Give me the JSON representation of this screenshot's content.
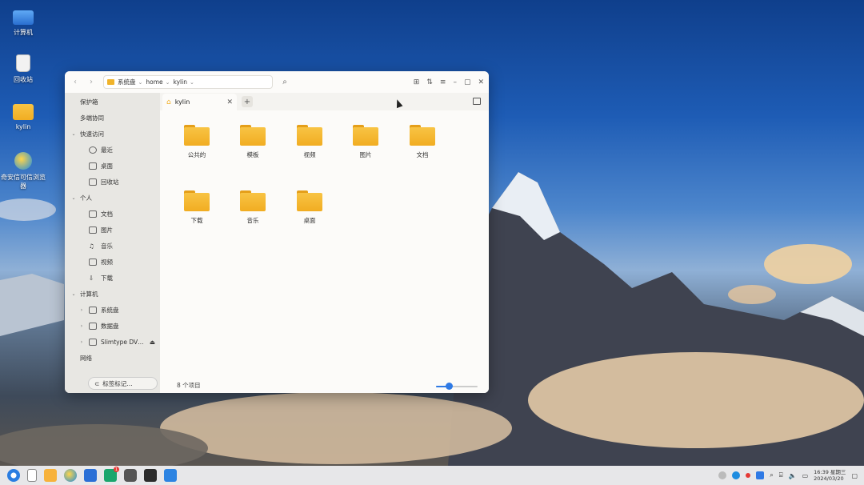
{
  "desktop": {
    "icons": [
      {
        "label": "计算机",
        "icon": "computer-icon"
      },
      {
        "label": "回收站",
        "icon": "trash-icon"
      },
      {
        "label": "kylin",
        "icon": "folder-icon"
      },
      {
        "label": "奇安信可信浏览器",
        "icon": "browser-icon"
      }
    ]
  },
  "window": {
    "nav": {
      "back": "‹",
      "forward": "›"
    },
    "breadcrumb": [
      "系统盘",
      "home",
      "kylin"
    ],
    "search_icon": "⌕",
    "toolbar_right": [
      "⊞",
      "⇅",
      "≡",
      "–",
      "▢",
      "✕"
    ],
    "sidebar": {
      "items": [
        {
          "label": "保护箱",
          "level": 0
        },
        {
          "label": "多端协同",
          "level": 0
        },
        {
          "label": "快速访问",
          "level": 0,
          "expander": "⌄"
        },
        {
          "label": "最近",
          "level": 1
        },
        {
          "label": "桌面",
          "level": 1
        },
        {
          "label": "回收站",
          "level": 1
        },
        {
          "label": "个人",
          "level": 0,
          "expander": "⌄"
        },
        {
          "label": "文档",
          "level": 1
        },
        {
          "label": "图片",
          "level": 1
        },
        {
          "label": "音乐",
          "level": 1
        },
        {
          "label": "视频",
          "level": 1
        },
        {
          "label": "下载",
          "level": 1
        },
        {
          "label": "计算机",
          "level": 0,
          "expander": "⌄"
        },
        {
          "label": "系统盘",
          "level": 1,
          "expander": "›"
        },
        {
          "label": "数据盘",
          "level": 1,
          "expander": "›"
        },
        {
          "label": "Slimtype DV…",
          "level": 1,
          "expander": "›",
          "eject": "⏏"
        },
        {
          "label": "网络",
          "level": 0
        }
      ],
      "bottom_button": "标签标记…"
    },
    "tab": {
      "label": "kylin",
      "close": "✕",
      "add": "+"
    },
    "folders": [
      "公共的",
      "模板",
      "视频",
      "图片",
      "文档",
      "下载",
      "音乐",
      "桌面"
    ],
    "status": "8 个项目",
    "zoom_level": 0.3
  },
  "taskbar": {
    "apps": [
      "start-menu-icon",
      "multitask-icon",
      "file-manager-icon",
      "browser-icon",
      "wps-icon",
      "app-store-icon",
      "settings-icon",
      "terminal-icon",
      "image-viewer-icon"
    ],
    "badge": "1",
    "clock_time": "16:39 星期三",
    "clock_date": "2024/03/20"
  },
  "colors": {
    "folder": "#f1ad22",
    "accent": "#2f7ae5"
  }
}
